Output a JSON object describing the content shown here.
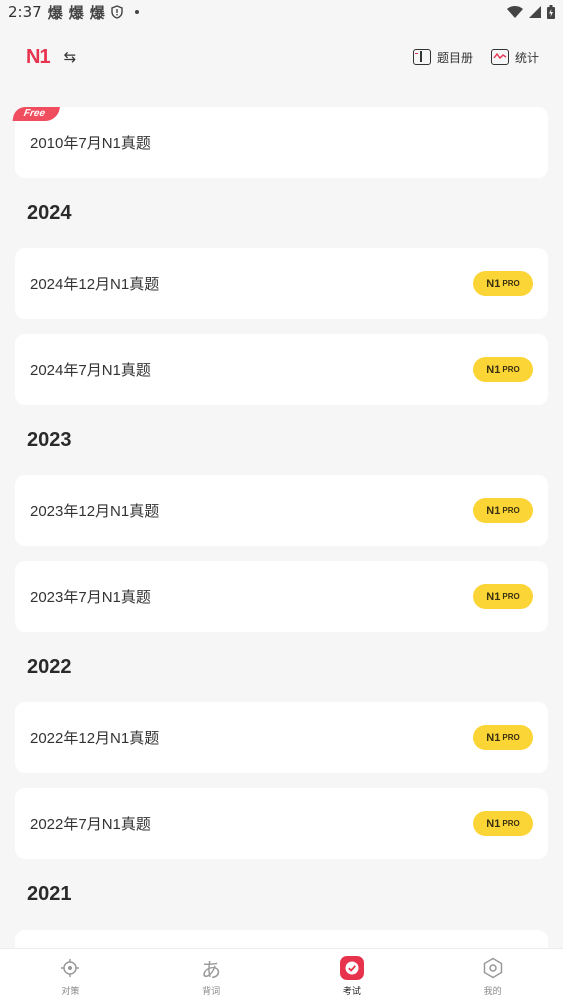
{
  "status_bar": {
    "time": "2:37",
    "notif_glyphs": [
      "爆",
      "爆",
      "爆"
    ]
  },
  "header": {
    "brand": "N1",
    "switch_icon": "swap-arrows",
    "actions": [
      {
        "label": "题目册",
        "icon": "book-icon"
      },
      {
        "label": "统计",
        "icon": "chart-icon"
      }
    ]
  },
  "free_card": {
    "tag": "Free",
    "title": "2010年7月N1真题"
  },
  "sections": [
    {
      "year": "2024",
      "papers": [
        "2024年12月N1真题",
        "2024年7月N1真题"
      ]
    },
    {
      "year": "2023",
      "papers": [
        "2023年12月N1真题",
        "2023年7月N1真题"
      ]
    },
    {
      "year": "2022",
      "papers": [
        "2022年12月N1真题",
        "2022年7月N1真题"
      ]
    },
    {
      "year": "2021",
      "papers": []
    }
  ],
  "pro_badge": {
    "main": "N1",
    "sub": "PRO"
  },
  "bottom_nav": [
    {
      "label": "对策",
      "icon": "target-icon",
      "active": false
    },
    {
      "label": "背词",
      "icon": "hiragana-a-icon",
      "active": false
    },
    {
      "label": "考试",
      "icon": "exam-check-icon",
      "active": true
    },
    {
      "label": "我的",
      "icon": "profile-hexagon-icon",
      "active": false
    }
  ],
  "colors": {
    "brand_red": "#e8334e",
    "pro_yellow": "#fbd535",
    "background": "#f6f6f6"
  }
}
